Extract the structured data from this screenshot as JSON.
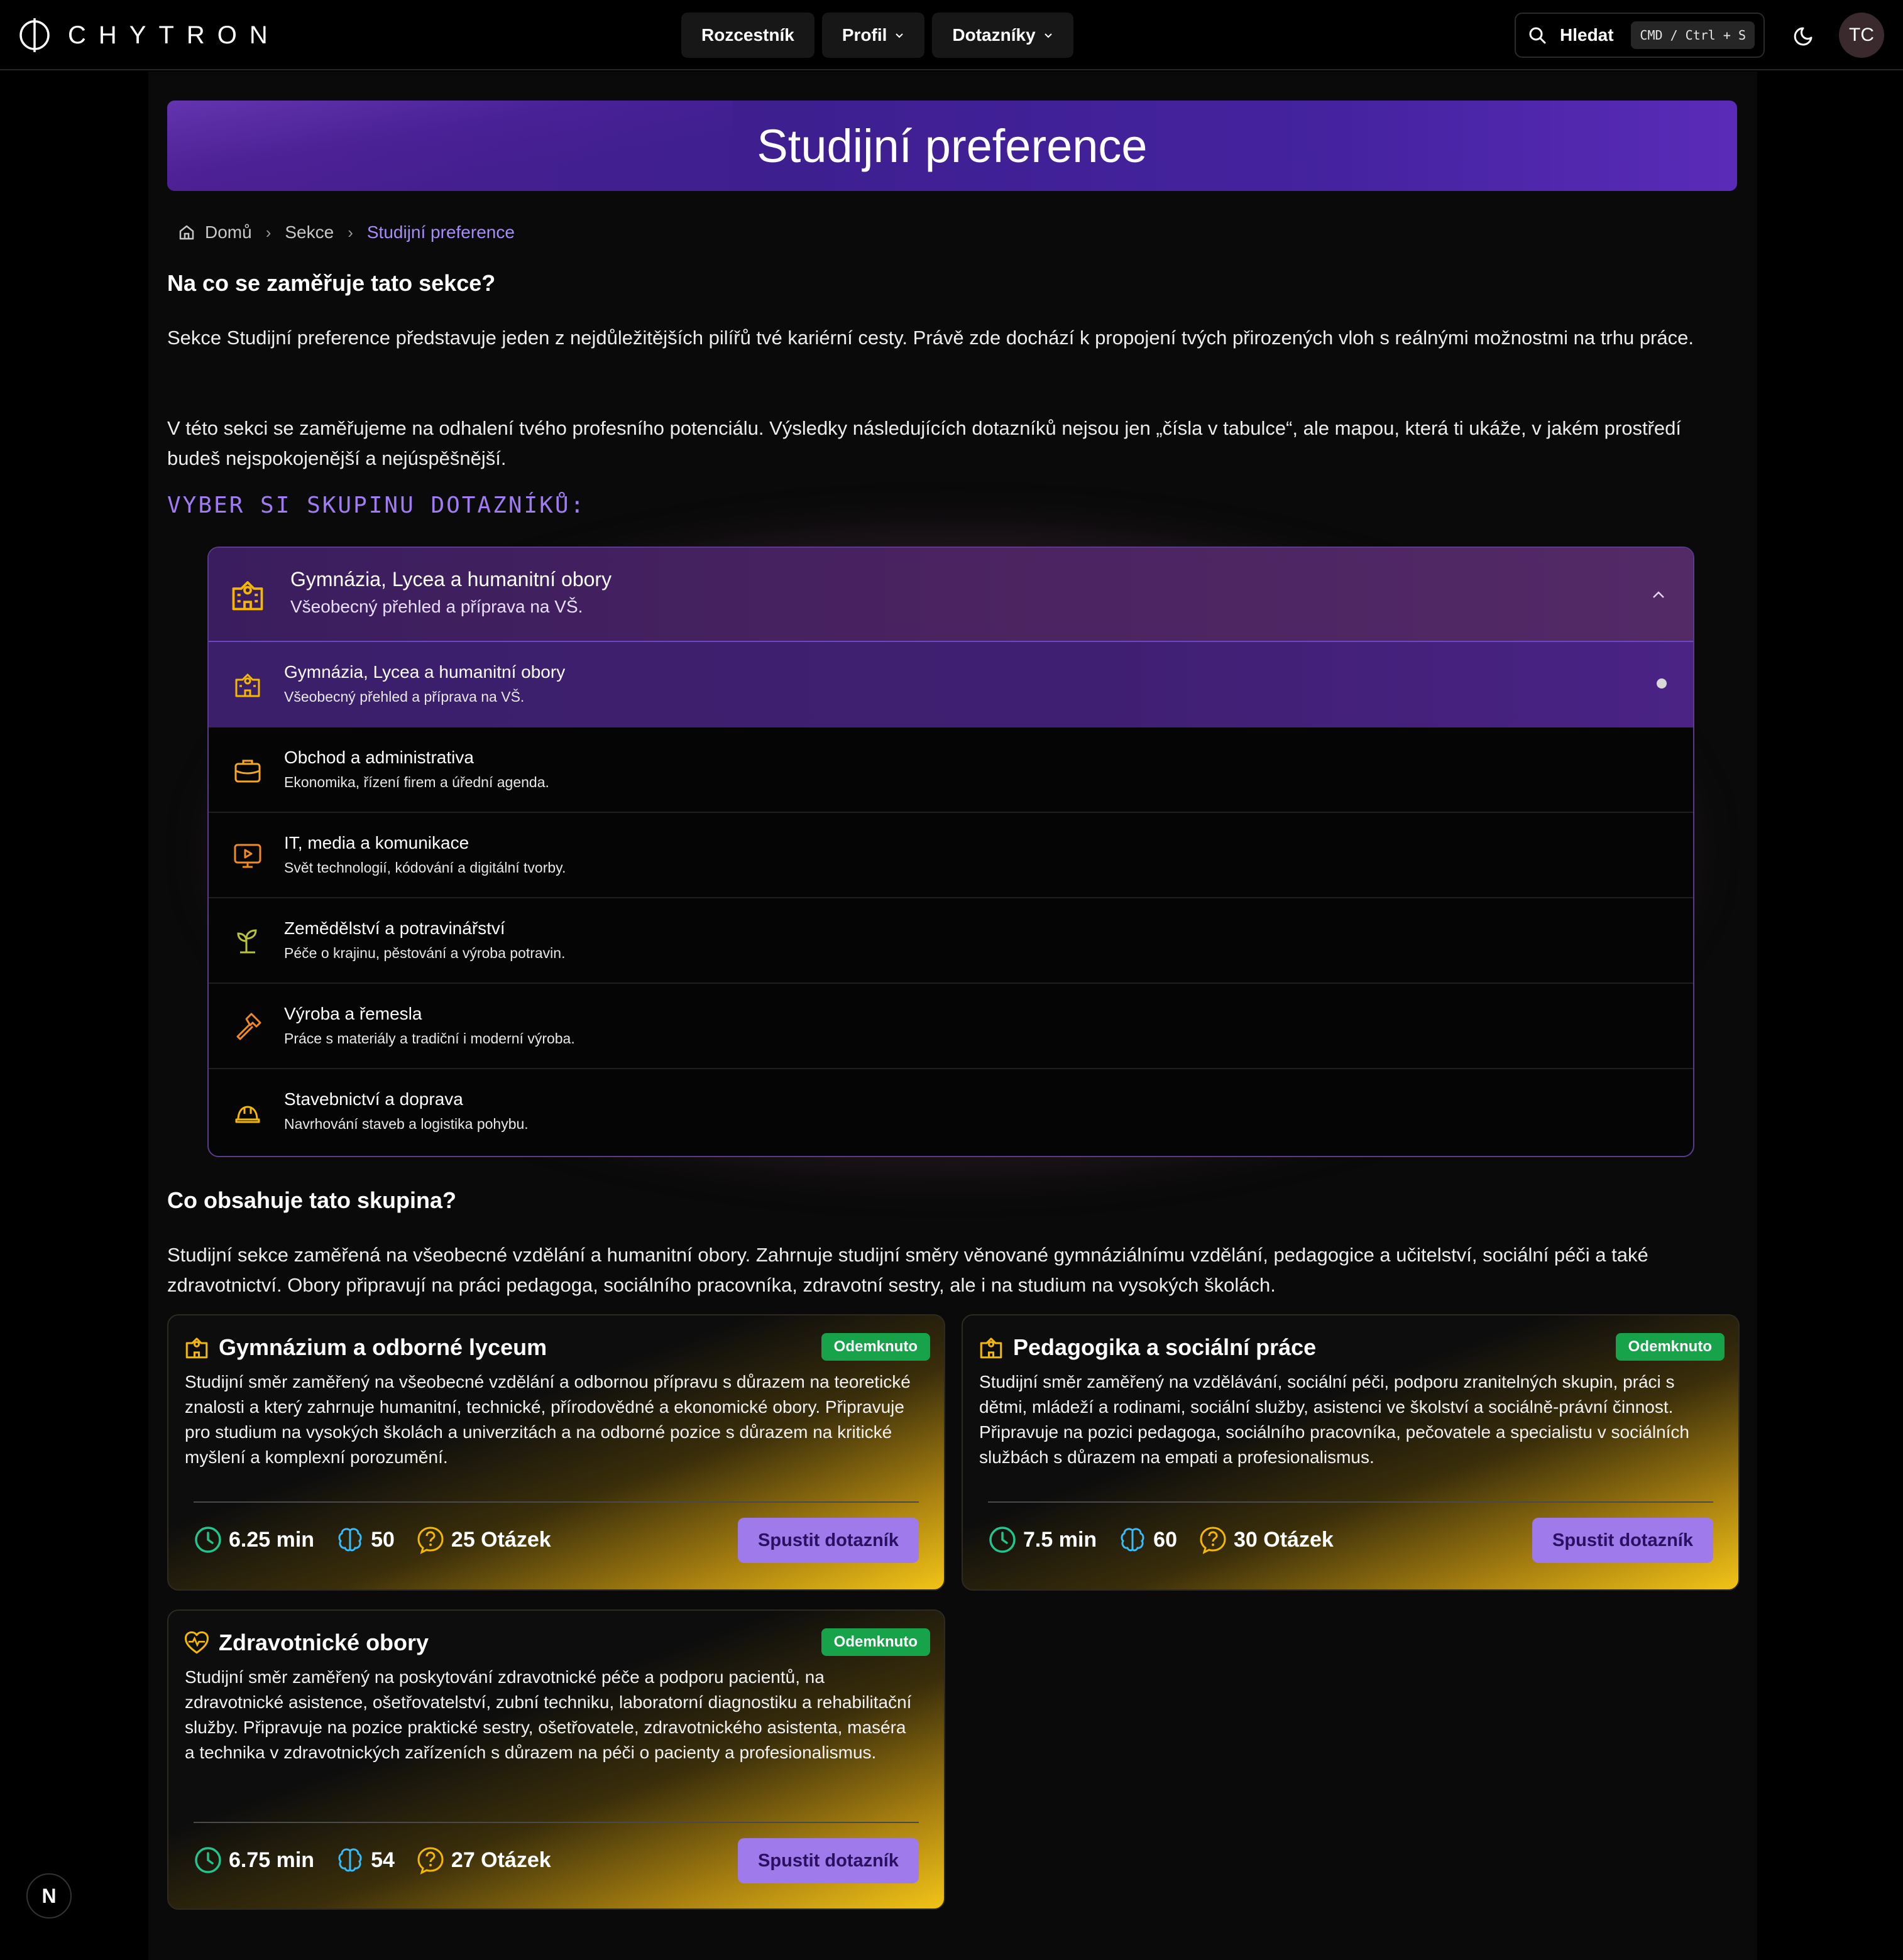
{
  "brand": {
    "name": "CHYTRON"
  },
  "nav": {
    "items": [
      {
        "label": "Rozcestník"
      },
      {
        "label": "Profil"
      },
      {
        "label": "Dotazníky"
      }
    ],
    "search_label": "Hledat",
    "search_shortcut": "CMD / Ctrl + S",
    "avatar_initials": "TC"
  },
  "hero": {
    "title": "Studijní preference"
  },
  "breadcrumb": {
    "home": "Domů",
    "section": "Sekce",
    "current": "Studijní preference"
  },
  "intro": {
    "heading": "Na co se zaměřuje tato sekce?",
    "paragraph1": "Sekce Studijní preference představuje jeden z nejdůležitějších pilířů tvé kariérní cesty. Právě zde dochází k propojení tvých přirozených vloh s reálnými možnostmi na trhu práce.",
    "paragraph2": "V této sekci se zaměřujeme na odhalení tvého profesního potenciálu. Výsledky následujících dotazníků nejsou jen „čísla v tabulce“, ale mapou, která ti ukáže, v jakém prostředí budeš nejspokojenější a nejúspěšnější."
  },
  "group_select": {
    "heading": "VYBER SI SKUPINU DOTAZNÍKŮ:",
    "selected": {
      "title": "Gymnázia, Lycea a humanitní obory",
      "subtitle": "Všeobecný přehled a příprava na VŠ."
    },
    "options": [
      {
        "title": "Gymnázia, Lycea a humanitní obory",
        "subtitle": "Všeobecný přehled a příprava na VŠ.",
        "icon": "school-icon"
      },
      {
        "title": "Obchod a administrativa",
        "subtitle": "Ekonomika, řízení firem a úřední agenda.",
        "icon": "briefcase-icon"
      },
      {
        "title": "IT, media a komunikace",
        "subtitle": "Svět technologií, kódování a digitální tvorby.",
        "icon": "monitor-play-icon"
      },
      {
        "title": "Zemědělství a potravinářství",
        "subtitle": "Péče o krajinu, pěstování a výroba potravin.",
        "icon": "sprout-icon"
      },
      {
        "title": "Výroba a řemesla",
        "subtitle": "Práce s materiály a tradiční i moderní výroba.",
        "icon": "hammer-icon"
      },
      {
        "title": "Stavebnictví a doprava",
        "subtitle": "Navrhování staveb a logistika pohybu.",
        "icon": "hard-hat-icon"
      }
    ]
  },
  "group_info": {
    "heading": "Co obsahuje tato skupina?",
    "paragraph": "Studijní sekce zaměřená na všeobecné vzdělání a humanitní obory. Zahrnuje studijní směry věnované gymnáziálnímu vzdělání, pedagogice a učitelství, sociální péči a také zdravotnictví. Obory připravují na práci pedagoga, sociálního pracovníka, zdravotní sestry, ale i na studium na vysokých školách."
  },
  "cards": [
    {
      "title": "Gymnázium a odborné lyceum",
      "badge": "Odemknuto",
      "description": "Studijní směr zaměřený na všeobecné vzdělání a odbornou přípravu s důrazem na teoretické znalosti a který zahrnuje humanitní, technické, přírodovědné a ekonomické obory. Připravuje pro studium na vysokých školách a univerzitách a na odborné pozice s důrazem na kritické myšlení a komplexní porozumění.",
      "time": "6.25 min",
      "score": "50",
      "questions": "25 Otázek",
      "button": "Spustit dotazník"
    },
    {
      "title": "Pedagogika a sociální práce",
      "badge": "Odemknuto",
      "description": "Studijní směr zaměřený na vzdělávání, sociální péči, podporu zranitelných skupin, práci s dětmi, mládeží a rodinami, sociální služby, asistenci ve školství a sociálně-právní činnost. Připravuje na pozici pedagoga, sociálního pracovníka, pečovatele a specialistu v sociálních službách s důrazem na empati a profesionalismus.",
      "time": "7.5 min",
      "score": "60",
      "questions": "30 Otázek",
      "button": "Spustit dotazník"
    },
    {
      "title": "Zdravotnické obory",
      "badge": "Odemknuto",
      "description": "Studijní směr zaměřený na poskytování zdravotnické péče a podporu pacientů, na zdravotnické asistence, ošetřovatelství, zubní techniku, laboratorní diagnostiku a rehabilitační služby. Připravuje na pozice praktické sestry, ošetřovatele, zdravotnického asistenta, maséra a technika v zdravotnických zařízeních s důrazem na péči o pacienty a profesionalismus.",
      "time": "6.75 min",
      "score": "54",
      "questions": "27 Otázek",
      "button": "Spustit dotazník"
    }
  ],
  "dev_badge": "N",
  "colors": {
    "accent_purple": "#a78bfa",
    "badge_green": "#16a34a",
    "icon_gold": "#f5b800",
    "button_purple": "#9f7aea"
  }
}
